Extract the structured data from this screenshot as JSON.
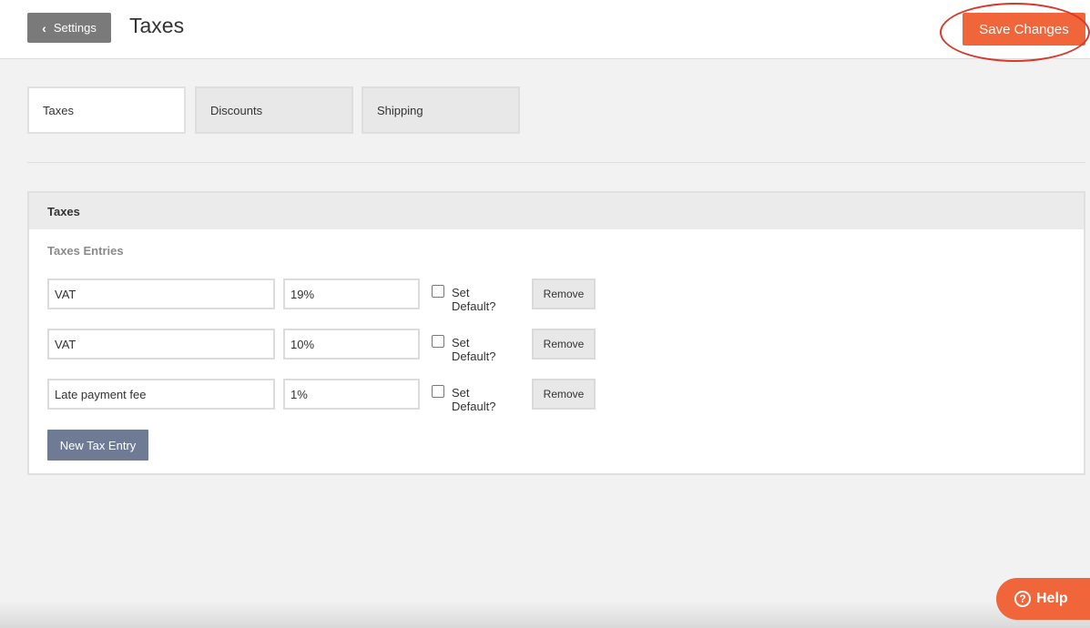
{
  "header": {
    "back_label": "Settings",
    "back_icon": "chevron-left-icon",
    "title": "Taxes",
    "save_label": "Save Changes"
  },
  "tabs": [
    {
      "label": "Taxes",
      "active": true
    },
    {
      "label": "Discounts",
      "active": false
    },
    {
      "label": "Shipping",
      "active": false
    }
  ],
  "panel": {
    "title": "Taxes",
    "section_label": "Taxes Entries",
    "entries": [
      {
        "name": "VAT",
        "rate": "19%",
        "default_label": "Set Default?",
        "is_default": false,
        "remove_label": "Remove"
      },
      {
        "name": "VAT",
        "rate": "10%",
        "default_label": "Set Default?",
        "is_default": false,
        "remove_label": "Remove"
      },
      {
        "name": "Late payment fee",
        "rate": "1%",
        "default_label": "Set Default?",
        "is_default": false,
        "remove_label": "Remove"
      }
    ],
    "new_entry_label": "New Tax Entry"
  },
  "help": {
    "label": "Help",
    "icon": "question-circle-icon"
  },
  "colors": {
    "accent": "#f0653a",
    "annotation_ring": "#d9372a",
    "secondary_button": "#6f7a94"
  }
}
